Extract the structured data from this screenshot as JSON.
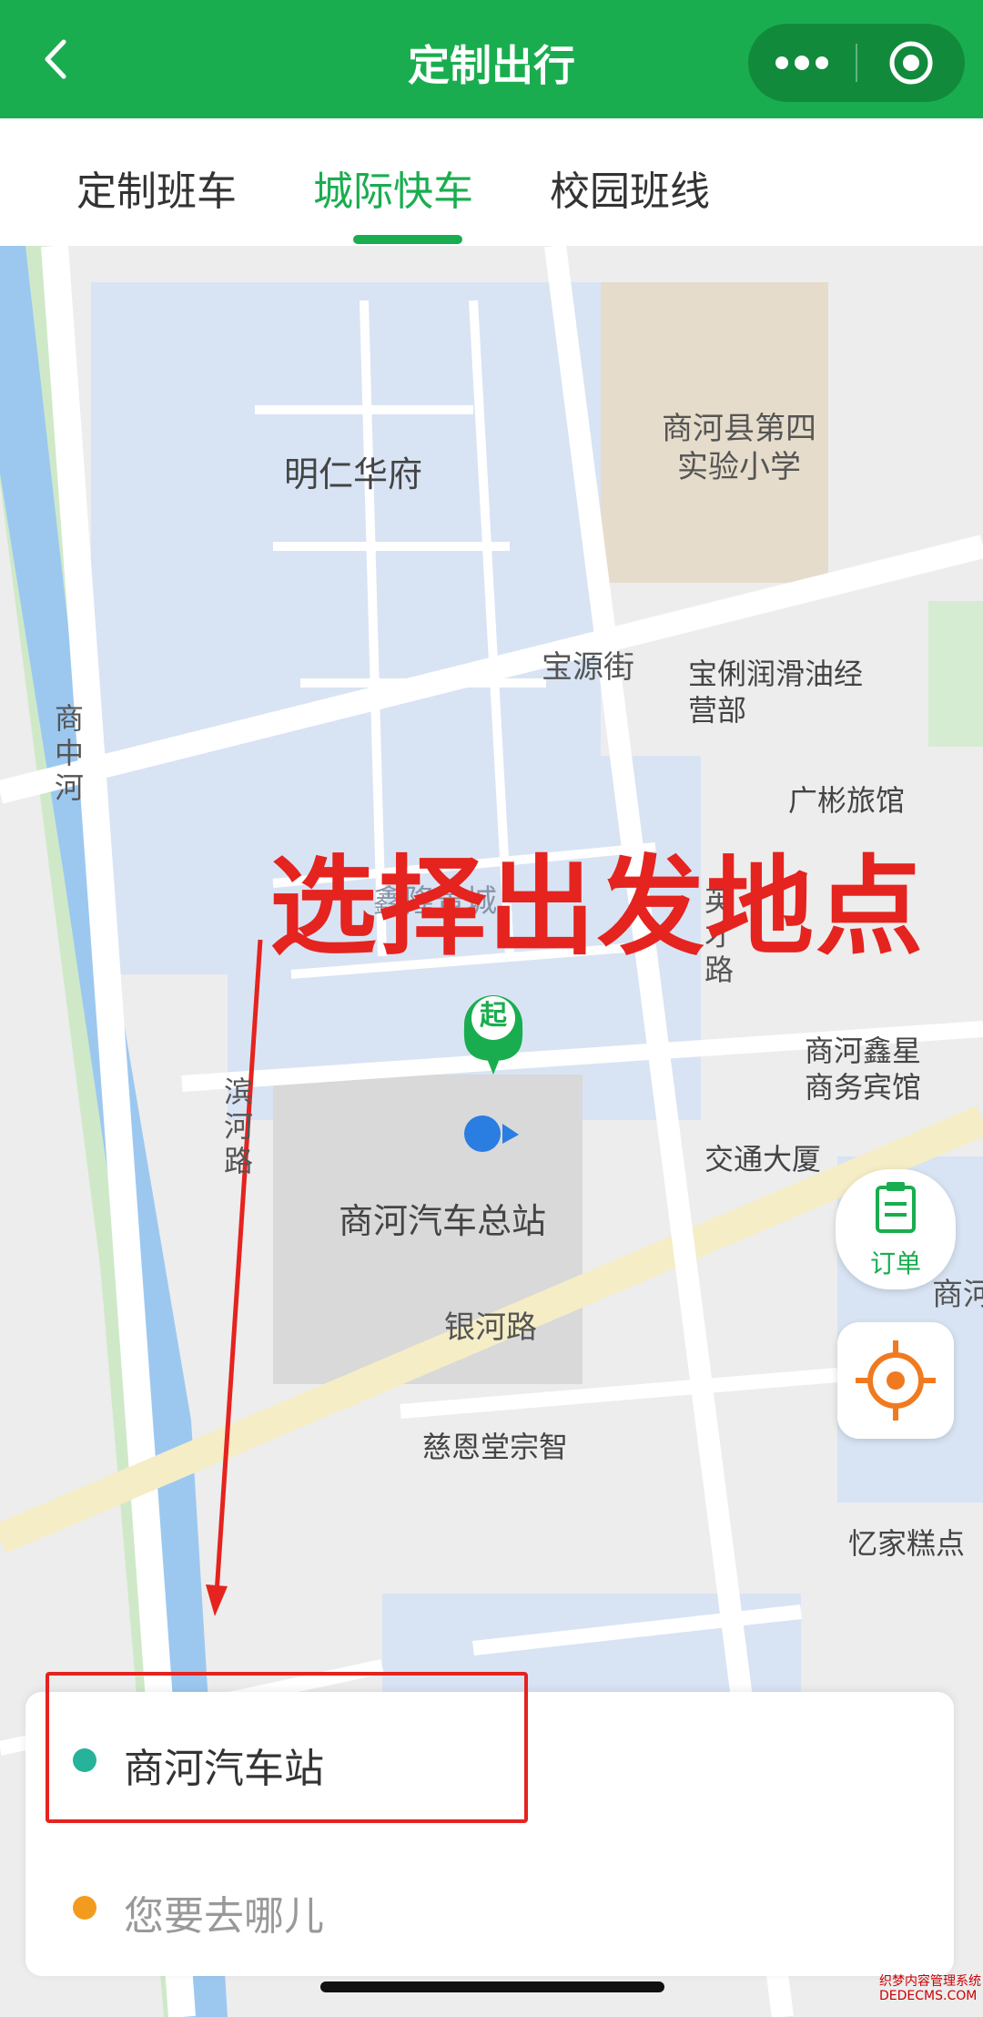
{
  "header": {
    "title": "定制出行",
    "back_icon": "chevron-left-icon",
    "more_icon": "more-dots-icon",
    "close_icon": "target-circle-icon",
    "background": "#1aad4f"
  },
  "tabs": [
    {
      "label": "定制班车",
      "active": false
    },
    {
      "label": "城际快车",
      "active": true
    },
    {
      "label": "校园班线",
      "active": false
    }
  ],
  "map": {
    "labels": {
      "mingren": "明仁华府",
      "school": "商河县第四实验小学",
      "baoyuan": "宝源街",
      "baoli": "宝俐润滑油经营部",
      "guangbin": "广彬旅馆",
      "xinjing": "鑫隆景城",
      "yingcai": "英才路",
      "xinxing": "商河鑫星商务宾馆",
      "jiaotong": "交通大厦",
      "station": "商河汽车总站",
      "yinhe": "银河路",
      "binhe": "滨河路",
      "shangzhonghe": "商中河",
      "cien": "慈恩堂宗智",
      "yijia": "忆家糕点",
      "shanghe_edge": "商河"
    },
    "start_marker": "起",
    "annotation": "选择出发地点"
  },
  "fab": {
    "order_label": "订单",
    "order_icon": "clipboard-icon",
    "locate_icon": "crosshair-icon"
  },
  "panel": {
    "origin": "商河汽车站",
    "destination_placeholder": "您要去哪儿",
    "origin_dot_color": "#26b39a",
    "destination_dot_color": "#f29b1f"
  },
  "watermark": "织梦内容管理系统 DEDECMS.COM"
}
